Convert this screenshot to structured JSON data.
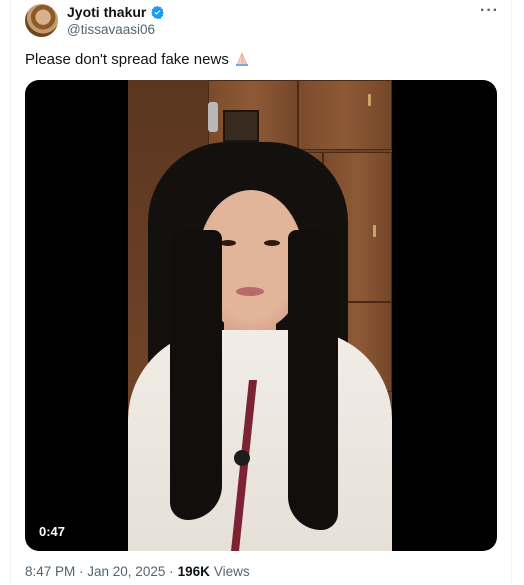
{
  "author": {
    "display_name": "Jyoti thakur",
    "handle": "@tissavaasi06",
    "verified": true,
    "verified_color": "#1d9bf0"
  },
  "post": {
    "text": "Please don't spread fake news",
    "emoji": "folded-hands"
  },
  "video": {
    "duration": "0:47"
  },
  "meta": {
    "timestamp": "8:47 PM · Jan 20, 2025 · ",
    "views_count": "196K",
    "views_label": "Views"
  },
  "menu": {
    "more_icon": "more-horizontal-icon",
    "more_label": "···"
  }
}
